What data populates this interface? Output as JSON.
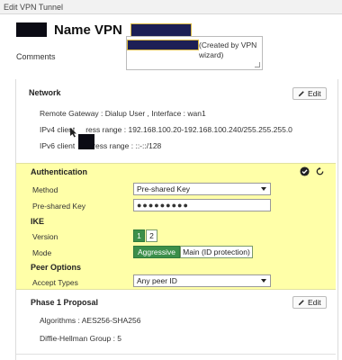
{
  "window": {
    "title": "Edit VPN Tunnel"
  },
  "header": {
    "name_label": "Name VPN"
  },
  "comments": {
    "label": "Comments",
    "value": "(Created by VPN wizard)"
  },
  "network": {
    "title": "Network",
    "edit_label": "Edit",
    "remote_gateway": "Remote Gateway : Dialup User , Interface : wan1",
    "ipv4_prefix": "IPv4 client",
    "ipv4_suffix": "ress range : 192.168.100.20-192.168.100.240/255.255.255.0",
    "ipv6_prefix": "IPv6 client",
    "ipv6_suffix": "ress range : ::-::/128"
  },
  "authentication": {
    "title": "Authentication",
    "method_label": "Method",
    "method_value": "Pre-shared Key",
    "psk_label": "Pre-shared Key",
    "psk_value": "●●●●●●●●●",
    "ike_title": "IKE",
    "version_label": "Version",
    "version_options": [
      "1",
      "2"
    ],
    "mode_label": "Mode",
    "mode_options": [
      "Aggressive",
      "Main (ID protection)"
    ],
    "peer_title": "Peer Options",
    "accept_label": "Accept Types",
    "accept_value": "Any peer ID"
  },
  "phase1": {
    "title": "Phase 1 Proposal",
    "edit_label": "Edit",
    "algorithms": "Algorithms : AES256-SHA256",
    "dh_group": "Diffie-Hellman Group : 5"
  },
  "colors": {
    "auth_bg": "#ffffa8",
    "active_toggle": "#3c8f4a"
  }
}
